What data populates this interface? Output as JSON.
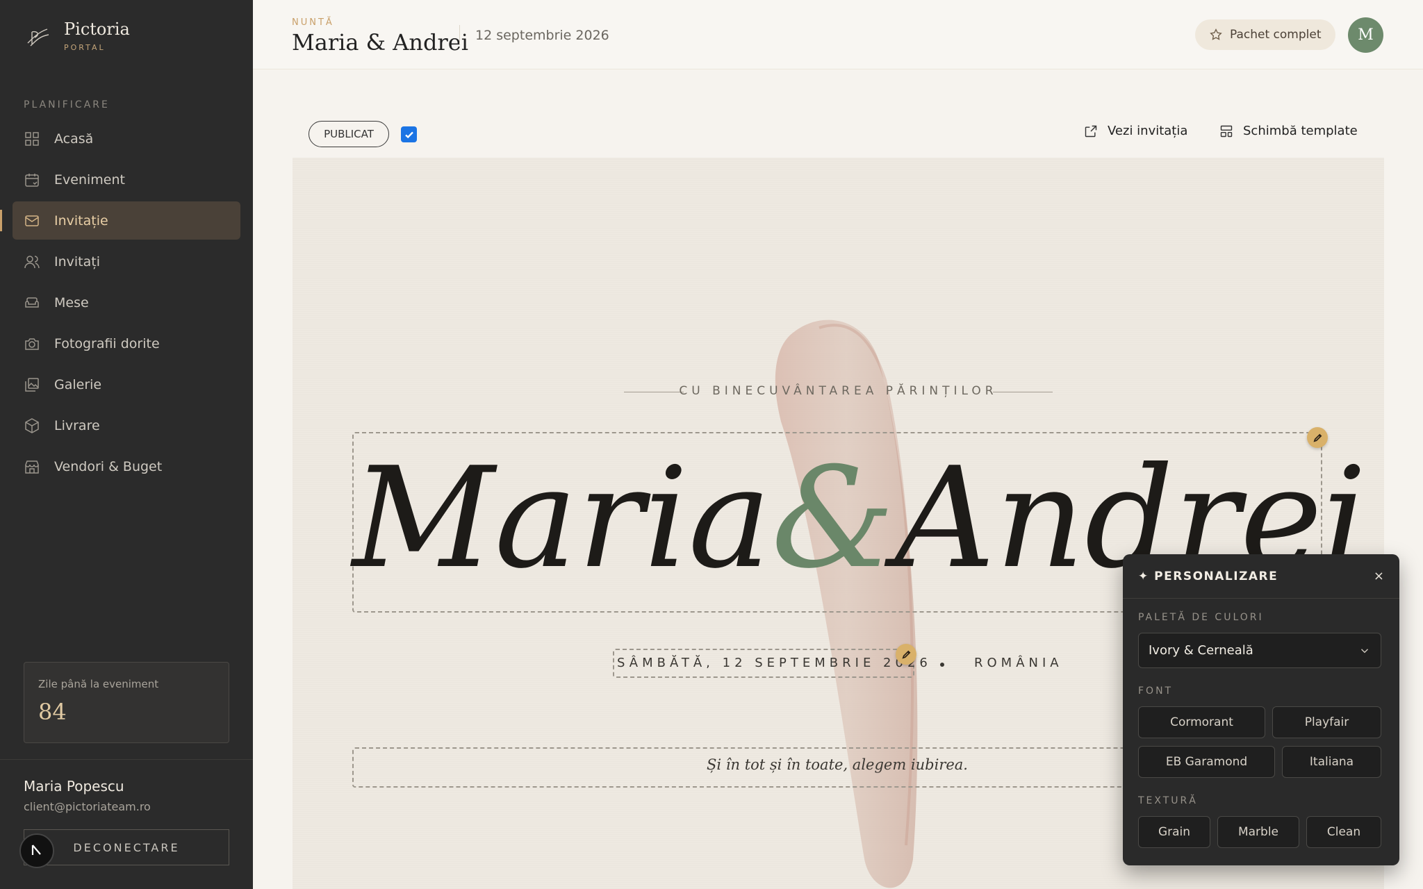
{
  "brand": {
    "name": "Pictoria",
    "sub": "PORTAL"
  },
  "sidebar": {
    "section": "PLANIFICARE",
    "items": [
      {
        "label": "Acasă",
        "icon": "grid-icon"
      },
      {
        "label": "Eveniment",
        "icon": "calendar-icon"
      },
      {
        "label": "Invitație",
        "icon": "mail-icon",
        "active": true
      },
      {
        "label": "Invitați",
        "icon": "users-icon"
      },
      {
        "label": "Mese",
        "icon": "sofa-icon"
      },
      {
        "label": "Fotografii dorite",
        "icon": "camera-icon"
      },
      {
        "label": "Galerie",
        "icon": "gallery-icon"
      },
      {
        "label": "Livrare",
        "icon": "package-icon"
      },
      {
        "label": "Vendori & Buget",
        "icon": "store-icon"
      }
    ],
    "countdown": {
      "label": "Zile până la eveniment",
      "value": "84"
    },
    "user": {
      "name": "Maria Popescu",
      "email": "client@pictoriateam.ro"
    },
    "logout": "DECONECTARE"
  },
  "header": {
    "kicker": "NUNTĂ",
    "title": "Maria & Andrei",
    "date": "12 septembrie 2026",
    "package": "Pachet complet",
    "avatar": "M"
  },
  "toolbar": {
    "status": "PUBLICAT",
    "published": true,
    "view": "Vezi invitația",
    "template": "Schimbă template"
  },
  "invitation": {
    "blessing": "CU BINECUVÂNTAREA PĂRINȚILOR",
    "name1": "Maria",
    "amp": "&",
    "name2": "Andrei",
    "date": "SÂMBĂTĂ, 12 SEPTEMBRIE 2026",
    "country": "ROMÂNIA",
    "quote": "Și în tot și în toate, alegem iubirea."
  },
  "panel": {
    "title": "✦ PERSONALIZARE",
    "close": "×",
    "palette_label": "PALETĂ DE CULORI",
    "palette_value": "Ivory & Cerneală",
    "font_label": "FONT",
    "fonts": [
      "Cormorant",
      "Playfair",
      "EB Garamond",
      "Italiana"
    ],
    "texture_label": "TEXTURĂ",
    "textures": [
      "Grain",
      "Marble",
      "Clean"
    ]
  },
  "colors": {
    "accent": "#c9a06a",
    "sage": "#6a8769",
    "sidebar": "#2b2b2b",
    "check": "#1b74e4"
  }
}
